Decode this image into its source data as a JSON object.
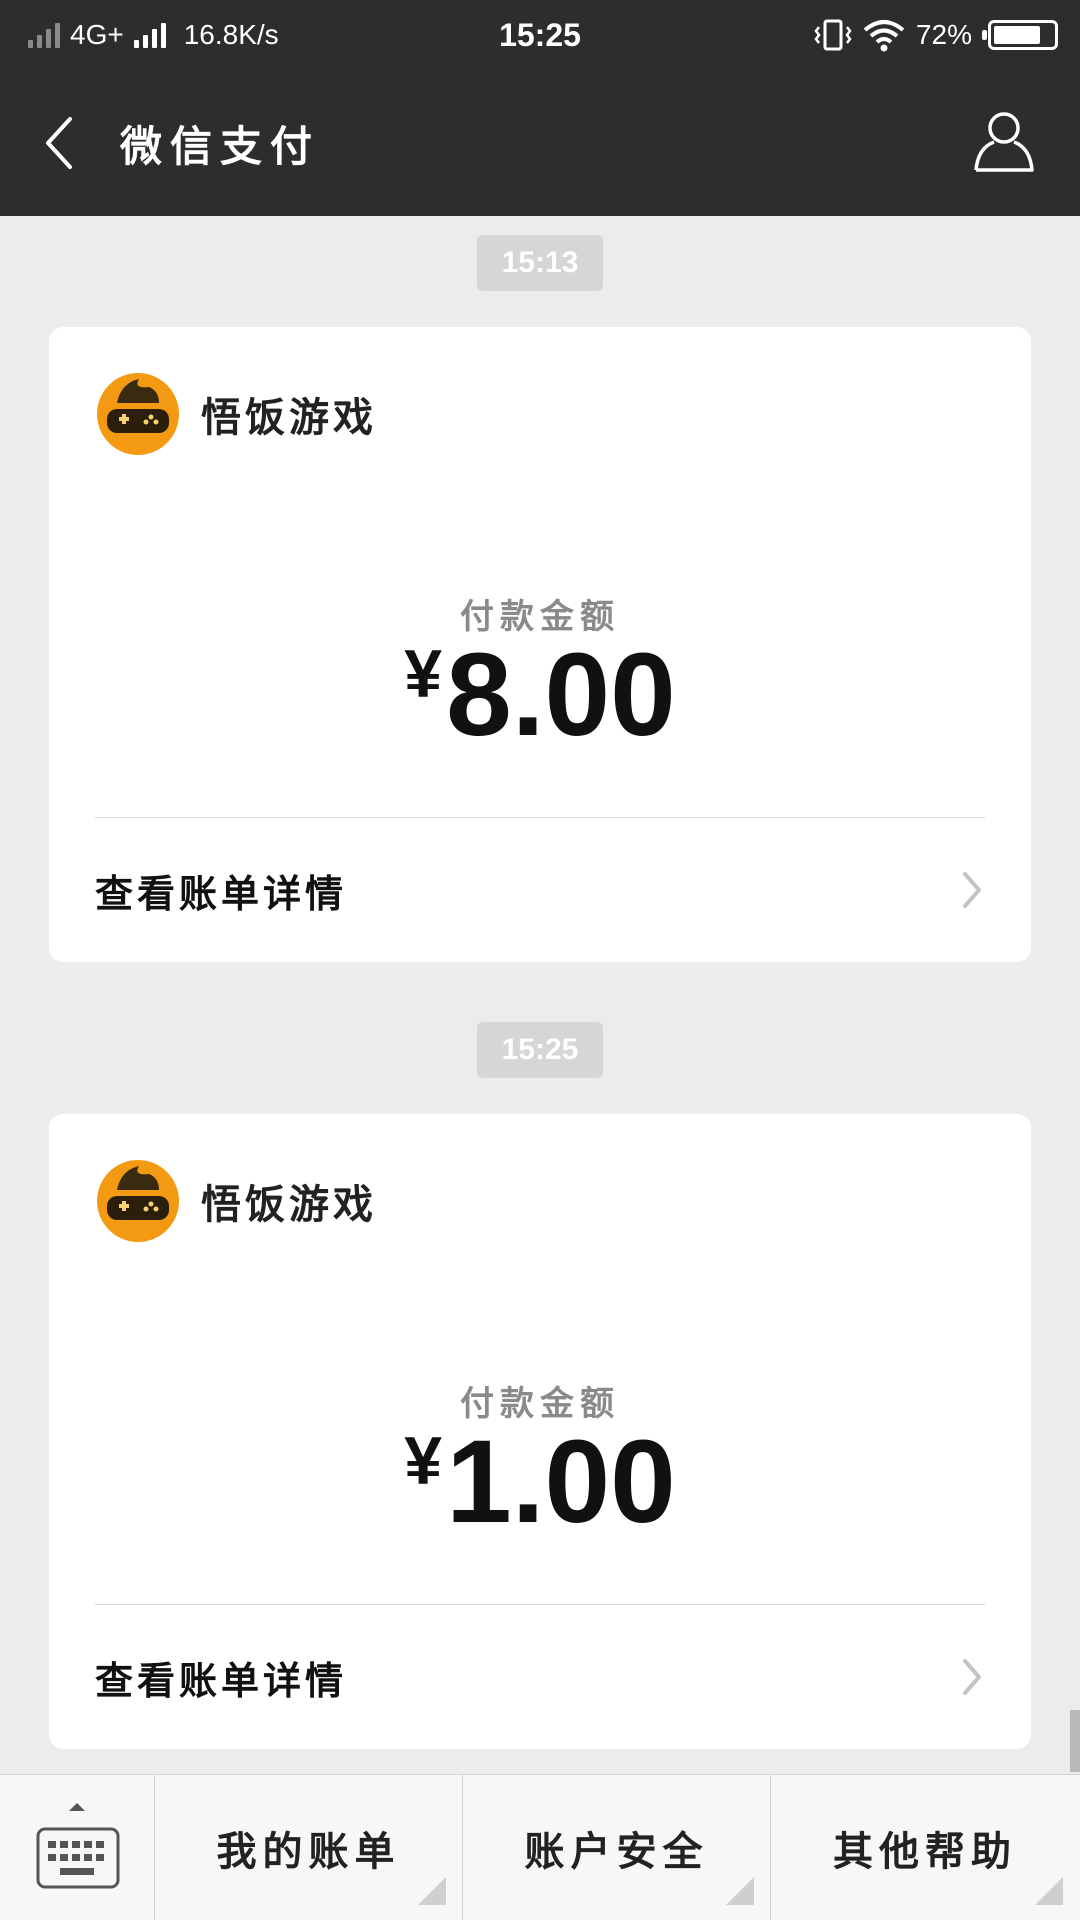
{
  "status_bar": {
    "network": "4G+",
    "speed": "16.8K/s",
    "time": "15:25",
    "battery": "72%"
  },
  "header": {
    "title": "微信支付"
  },
  "messages": [
    {
      "timestamp": "15:13",
      "merchant": "悟饭游戏",
      "amount_label": "付款金额",
      "currency": "¥",
      "amount": "8.00",
      "detail_link": "查看账单详情"
    },
    {
      "timestamp": "15:25",
      "merchant": "悟饭游戏",
      "amount_label": "付款金额",
      "currency": "¥",
      "amount": "1.00",
      "detail_link": "查看账单详情"
    }
  ],
  "bottom_menu": {
    "items": [
      "我的账单",
      "账户安全",
      "其他帮助"
    ]
  },
  "icons": {
    "back": "chevron-left-icon",
    "profile": "user-icon",
    "keyboard": "keyboard-icon",
    "detail_arrow": "chevron-right-icon"
  },
  "colors": {
    "header_bg": "#2d2d2d",
    "page_bg": "#ececec",
    "logo_orange": "#f39a12"
  }
}
